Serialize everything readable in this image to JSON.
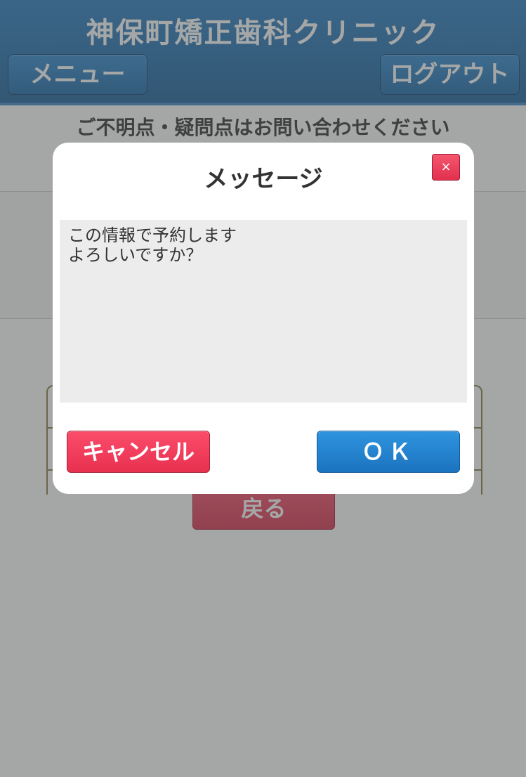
{
  "header": {
    "title": "神保町矯正歯科クリニック",
    "menu_label": "メニュー",
    "logout_label": "ログアウト"
  },
  "notice": "ご不明点・疑問点はお問い合わせください",
  "back_label": "戻る",
  "dialog": {
    "title": "メッセージ",
    "close_symbol": "×",
    "message_lines": [
      "この情報で予約します",
      "よろしいですか？"
    ],
    "cancel_label": "キャンセル",
    "ok_label": "ＯＫ"
  },
  "colors": {
    "header_blue": "#1a5f9a",
    "button_red": "#e8304f",
    "button_blue": "#1c73bf",
    "overlay": "#4b5050"
  }
}
